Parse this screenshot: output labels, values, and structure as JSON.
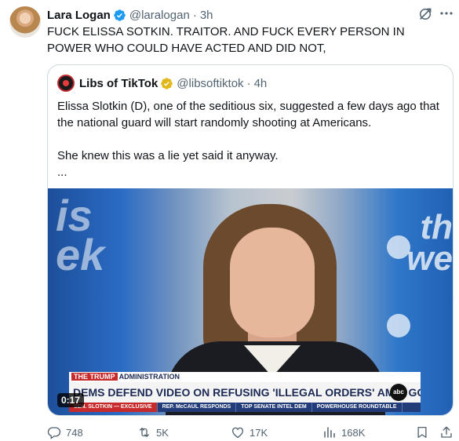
{
  "author": {
    "name": "Lara Logan",
    "handle": "@laralogan",
    "separator": "·",
    "time": "3h"
  },
  "tweet_text": "FUCK ELISSA SOTKIN. TRAITOR. AND FUCK EVERY PERSON IN POWER WHO COULD HAVE ACTED AND DID NOT,",
  "quoted": {
    "name": "Libs of TikTok",
    "handle": "@libsoftiktok",
    "separator": "·",
    "time": "4h",
    "text_lines": [
      "Elissa Slotkin (D), one of the seditious six, suggested a few days ago that the national guard will start randomly shooting at Americans.",
      "",
      "She knew this was a lie yet said it anyway.",
      "..."
    ],
    "video": {
      "timer": "0:17",
      "bg_left_text": "is\nek",
      "bg_right_text": "th\nwe",
      "chyron_top_tag": "THE TRUMP",
      "chyron_top_text": "ADMINISTRATION",
      "chyron_main": "DEMS DEFEND VIDEO ON REFUSING 'ILLEGAL ORDERS' AMID GOP BACKLASH",
      "chyron_logo": "abc",
      "chyron_bottom": [
        "SEN. SLOTKIN — EXCLUSIVE",
        "REP. McCAUL RESPONDS",
        "TOP SENATE INTEL DEM",
        "POWERHOUSE ROUNDTABLE"
      ]
    }
  },
  "actions": {
    "reply_count": "748",
    "retweet_count": "5K",
    "like_count": "17K",
    "views_count": "168K"
  },
  "icons": {
    "verified": "verified-blue-badge-icon",
    "quoted_verified": "verified-gold-badge-icon",
    "grok": "grok-icon",
    "more": "more-icon",
    "reply": "reply-icon",
    "retweet": "retweet-icon",
    "like": "heart-icon",
    "views": "views-bar-chart-icon",
    "bookmark": "bookmark-icon",
    "share": "share-icon"
  },
  "colors": {
    "verified_blue": "#1d9bf0",
    "gold_badge": "#e2b719",
    "secondary_text": "#536471",
    "border": "#cfd9de"
  }
}
